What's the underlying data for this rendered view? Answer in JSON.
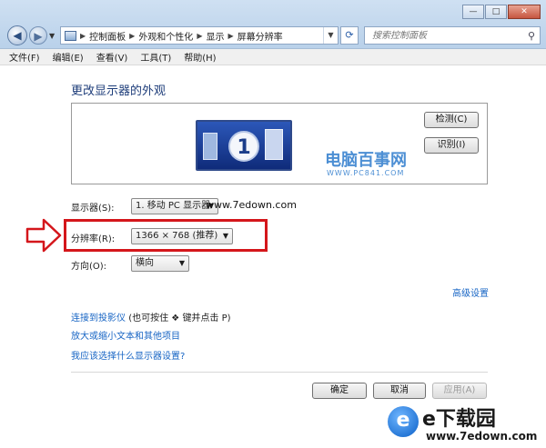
{
  "window": {
    "controls": [
      "—",
      "□",
      "✕"
    ]
  },
  "toolbar": {
    "address_crumbs": [
      "控制面板",
      "外观和个性化",
      "显示",
      "屏幕分辨率"
    ],
    "search_placeholder": "搜索控制面板"
  },
  "menu": [
    "文件(F)",
    "编辑(E)",
    "查看(V)",
    "工具(T)",
    "帮助(H)"
  ],
  "main": {
    "heading": "更改显示器的外观",
    "monitor_number": "1",
    "watermark_title": "电脑百事网",
    "watermark_sub": "WWW.PC841.COM",
    "detect_button": "检测(C)",
    "identify_button": "识别(I)",
    "display_label": "显示器(S):",
    "display_value": "1. 移动 PC 显示器",
    "overlay_url": "www.7edown.com",
    "resolution_label": "分辨率(R):",
    "resolution_value": "1366 × 768 (推荐)",
    "orientation_label": "方向(O):",
    "orientation_value": "横向",
    "advanced_link": "高级设置",
    "link_projector": "连接到投影仪",
    "link_projector_hint_a": "(也可按住",
    "link_projector_hint_b": "键并点击 P)",
    "link_textsize": "放大或缩小文本和其他项目",
    "link_which": "我应该选择什么显示器设置?",
    "ok_button": "确定",
    "cancel_button": "取消",
    "apply_button": "应用(A)"
  },
  "brand": {
    "logo_letter": "e",
    "logo_title": "e下载园",
    "logo_url": "www.7edown.com"
  }
}
